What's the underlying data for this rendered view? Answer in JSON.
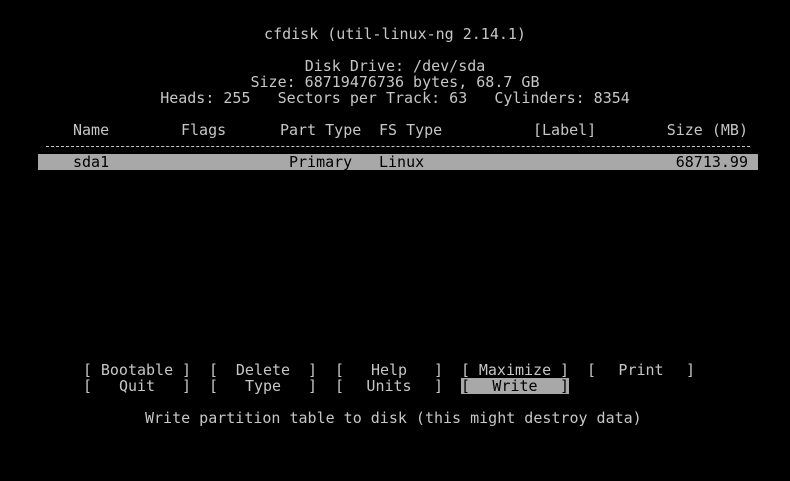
{
  "header": {
    "title": "cfdisk (util-linux-ng 2.14.1)",
    "disk_drive": "Disk Drive: /dev/sda",
    "size_line": "Size: 68719476736 bytes, 68.7 GB",
    "geometry_line": "Heads: 255   Sectors per Track: 63   Cylinders: 8354"
  },
  "table": {
    "columns": [
      "Name",
      "Flags",
      "Part Type",
      "FS Type",
      "[Label]",
      "Size (MB)"
    ],
    "rows": [
      {
        "name": "sda1",
        "flags": "",
        "part_type": "Primary",
        "fs_type": "Linux",
        "label": "",
        "size_mb": "68713.99"
      }
    ]
  },
  "menu": {
    "items": [
      "Bootable",
      "Delete",
      "Help",
      "Maximize",
      "Print",
      "Quit",
      "Type",
      "Units",
      "Write"
    ],
    "selected": "Write",
    "help_text": "Write partition table to disk (this might destroy data)"
  },
  "colors": {
    "background": "#000000",
    "text": "#c6c6c6",
    "highlight": "#a8a8a8"
  }
}
